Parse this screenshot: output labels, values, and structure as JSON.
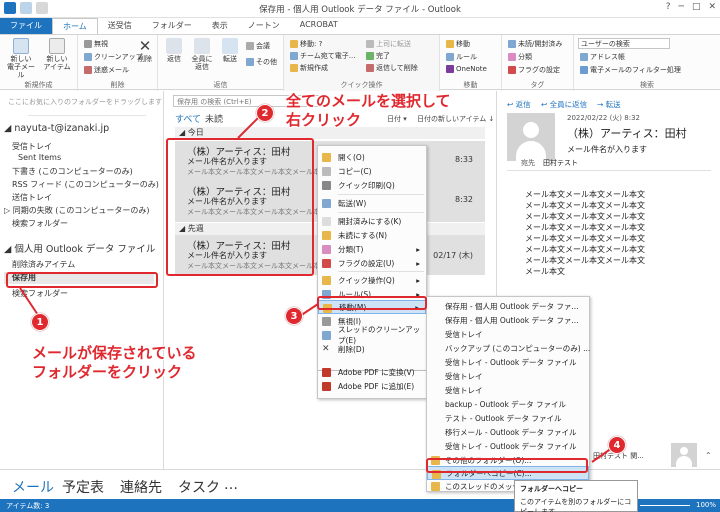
{
  "window": {
    "title": "保存用 - 個人用 Outlook データ ファイル - Outlook"
  },
  "tabs": [
    "ファイル",
    "ホーム",
    "送受信",
    "フォルダー",
    "表示",
    "ノートン",
    "ACROBAT"
  ],
  "ribbon": {
    "new_group": {
      "new_mail": "新しい\n電子メール",
      "new_items": "新しい\nアイテム",
      "label": "新規作成"
    },
    "delete_group": {
      "ignore": "無視",
      "cleanup": "クリーンアップ",
      "junk": "迷惑メール",
      "delete": "削除",
      "label": "削除"
    },
    "reply_group": {
      "reply": "返信",
      "reply_all": "全員に\n返信",
      "forward": "転送",
      "meeting": "会議",
      "more": "その他",
      "label": "返信"
    },
    "quick_group": {
      "move_to": "移動: ?",
      "to_manager": "上司に転送",
      "team_mail": "チーム宛て電子...",
      "done": "完了",
      "new_create": "新規作成",
      "reply_delete": "返信して削除",
      "label": "クイック操作"
    },
    "move_group": {
      "move": "移動",
      "rules": "ルール",
      "onenote": "OneNote",
      "label": "移動"
    },
    "tags_group": {
      "unread": "未読/開封済み",
      "categorize": "分類",
      "followup": "フラグの設定",
      "label": "タグ"
    },
    "find_group": {
      "search_people": "ユーザーの検索",
      "address_book": "アドレス帳",
      "filter_mail": "電子メールのフィルター処理",
      "label": "検索"
    }
  },
  "folder_pane": {
    "favorites_hint": "ここにお気に入りのフォルダーをドラッグします",
    "account": "nayuta-t@izanaki.jp",
    "account_folders": [
      "受信トレイ",
      "Sent Items",
      "下書き (このコンピューターのみ)",
      "RSS フィード (このコンピューターのみ)",
      "送信トレイ",
      "同期の失敗 (このコンピューターのみ)",
      "検索フォルダー"
    ],
    "pst": "個人用 Outlook データ ファイル",
    "pst_folders": [
      "削除済みアイテム",
      "保存用",
      "検索フォルダー"
    ]
  },
  "list_pane": {
    "search_placeholder": "保存用 の検索 (Ctrl+E)",
    "filter_all": "すべて",
    "filter_unread": "未読",
    "sort_date": "日付",
    "sort_newest": "日付の新しいアイテム",
    "group_today": "今日",
    "group_last_week": "先週",
    "messages": [
      {
        "sender": "（株）アーティス：田村",
        "subject": "メール件名が入ります",
        "preview": "メール本文メール本文メール本文メール本文",
        "time": "8:33"
      },
      {
        "sender": "（株）アーティス：田村",
        "subject": "メール件名が入ります",
        "preview": "メール本文メール本文メール本文メール本文",
        "time": "8:32"
      },
      {
        "sender": "（株）アーティス：田村",
        "subject": "メール件名が入ります",
        "preview": "メール本文メール本文メール本文メール本文",
        "time": "02/17 (木)"
      }
    ]
  },
  "read_pane": {
    "reply": "返信",
    "reply_all": "全員に返信",
    "forward": "転送",
    "date": "2022/02/22 (火) 8:32",
    "sender": "（株）アーティス：田村",
    "subject": "メール件名が入ります",
    "to_label": "宛先",
    "to": "田村テスト",
    "body": [
      "メール本文メール本文メール本文",
      "メール本文メール本文メール本文",
      "メール本文メール本文メール本文",
      "メール本文メール本文メール本文",
      "メール本文メール本文メール本文",
      "メール本文メール本文メール本文",
      "メール本文メール本文メール本文",
      "メール本文"
    ],
    "people_text": "田村テスト 関..."
  },
  "context_menu": [
    "開く(O)",
    "コピー(C)",
    "クイック印刷(Q)",
    "転送(W)",
    "開封済みにする(K)",
    "未読にする(N)",
    "分類(T)",
    "フラグの設定(U)",
    "クイック操作(Q)",
    "ルール(S)",
    "移動(M)",
    "無視(I)",
    "スレッドのクリーンアップ(E)",
    "削除(D)",
    "Adobe PDF に変換(V)",
    "Adobe PDF に追加(E)"
  ],
  "submenu": [
    "保存用 - 個人用 Outlook データ ファ...",
    "保存用 - 個人用 Outlook データ ファ...",
    "受信トレイ",
    "バックアップ (このコンピューターのみ) ...",
    "受信トレイ - Outlook データ ファイル",
    "受信トレイ",
    "受信トレイ",
    "backup - Outlook データ ファイル",
    "テスト - Outlook データ ファイル",
    "移行メール - Outlook データ ファイル",
    "受信トレイ - Outlook データ ファイル",
    "その他のフォルダー(O)...",
    "フォルダーへコピー(C)...",
    "このスレッドのメッセージを常に移動する(A)..."
  ],
  "tooltip": {
    "title": "フォルダーへコピー",
    "desc": "このアイテムを別のフォルダーにコピーします。"
  },
  "navbar": [
    "メール",
    "予定表",
    "連絡先",
    "タスク",
    "…"
  ],
  "status": {
    "items": "アイテム数: 3",
    "zoom": "100%"
  },
  "annotations": {
    "a1": "メールが保存されている\nフォルダーをクリック",
    "a2": "全てのメールを選択して\n右クリック",
    "n1": "1",
    "n2": "2",
    "n3": "3",
    "n4": "4"
  },
  "colors": {
    "accent": "#1e73be",
    "annotation": "#e0282f",
    "highlight": "#cfe3f7"
  }
}
